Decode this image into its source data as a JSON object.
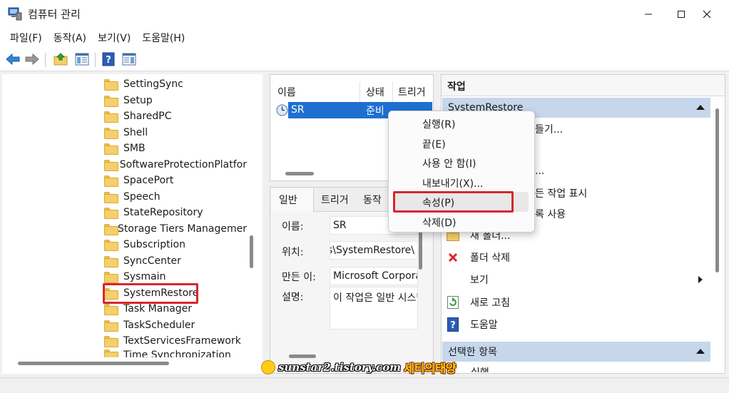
{
  "window": {
    "title": "컴퓨터 관리",
    "minimize_icon": "minimize-icon",
    "maximize_icon": "maximize-icon",
    "close_icon": "close-icon"
  },
  "menu": [
    "파일(F)",
    "동작(A)",
    "보기(V)",
    "도움말(H)"
  ],
  "toolbar": [
    "back-arrow-icon",
    "forward-arrow-icon",
    "up-folder-icon",
    "show-hide-tree-icon",
    "help-icon",
    "action-pane-icon"
  ],
  "tree": {
    "items": [
      "SettingSync",
      "Setup",
      "SharedPC",
      "Shell",
      "SMB",
      "SoftwareProtectionPlatfor",
      "SpacePort",
      "Speech",
      "StateRepository",
      "Storage Tiers Managemer",
      "Subscription",
      "SyncCenter",
      "Sysmain",
      "SystemRestore",
      "Task Manager",
      "TaskScheduler",
      "TextServicesFramework",
      "Time Synchronization"
    ],
    "selected": "SystemRestore"
  },
  "task_list": {
    "columns": [
      "이름",
      "상태",
      "트리거"
    ],
    "rows": [
      {
        "name": "SR",
        "status": "준비"
      }
    ]
  },
  "detail": {
    "tabs": [
      "일반",
      "트리거",
      "동작"
    ],
    "fields": [
      {
        "label": "이름:",
        "value": "SR"
      },
      {
        "label": "위치:",
        "value": "\\Microsoft\\Windows\\SystemRestore"
      },
      {
        "label": "만든 이:",
        "value": "Microsoft Corporation"
      },
      {
        "label": "설명:",
        "value": "이 작업은 일반 시스템 복원 지점을 만듭니다."
      }
    ]
  },
  "context_menu": {
    "items": [
      "실행(R)",
      "끝(E)",
      "사용 안 함(I)",
      "내보내기(X)...",
      "속성(P)",
      "삭제(D)"
    ],
    "highlighted": "속성(P)"
  },
  "actions": {
    "header": "작업",
    "section1": "SystemRestore",
    "partial_items": [
      "들기...",
      "...",
      "든 작업 표시",
      "록 사용"
    ],
    "items": [
      {
        "label": "새 폴더...",
        "icon": "new-folder-icon"
      },
      {
        "label": "폴더 삭제",
        "icon": "delete-x-icon"
      },
      {
        "label": "보기",
        "icon": "",
        "submenu": true
      },
      {
        "label": "새로 고침",
        "icon": "refresh-icon"
      },
      {
        "label": "도움말",
        "icon": "help-icon"
      }
    ],
    "section2": "선택한 항목",
    "section2_partial": "실행"
  },
  "watermark": {
    "url": "sunstar2.tistory.com",
    "name": "세티의태양"
  },
  "colors": {
    "selection": "#1f6fd1",
    "section_bar": "#c6d7ec",
    "highlight_box": "#d8262e"
  }
}
